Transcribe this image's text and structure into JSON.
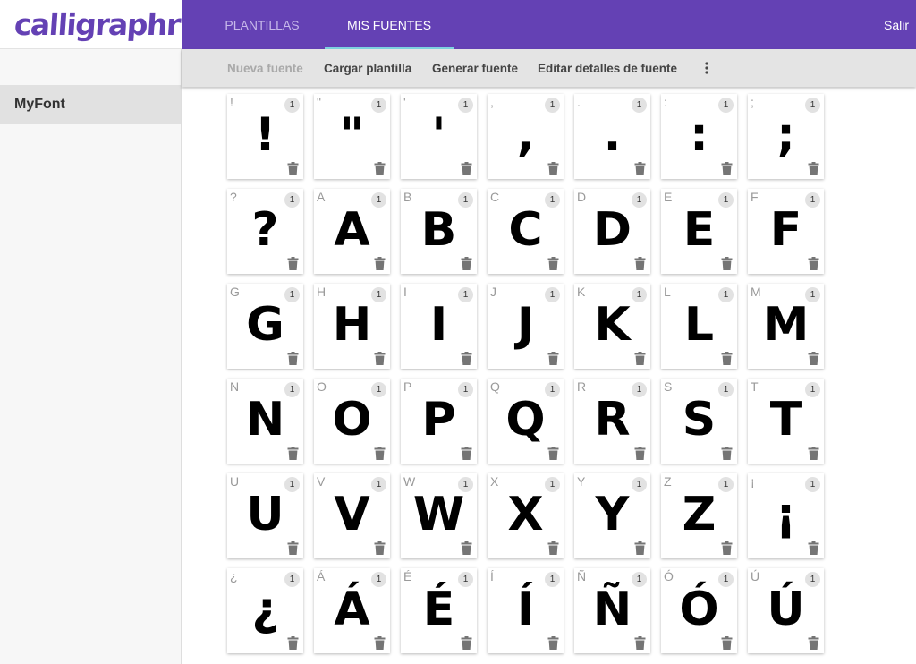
{
  "brand": {
    "logo_text": "calligraphr"
  },
  "nav": {
    "tabs": [
      {
        "label": "PLANTILLAS",
        "active": false
      },
      {
        "label": "MIS FUENTES",
        "active": true
      }
    ],
    "logout_label": "Salir"
  },
  "sidebar": {
    "fonts": [
      {
        "name": "MyFont",
        "selected": true
      }
    ]
  },
  "toolbar": {
    "new_font": "Nueva fuente",
    "load_template": "Cargar plantilla",
    "generate_font": "Generar fuente",
    "edit_details": "Editar detalles de fuente",
    "more_icon": "more-vert-icon"
  },
  "colors": {
    "header": "#6441b4",
    "active_tab_underline": "#7ed3e0",
    "toolbar_bg": "#e4e4e4",
    "sidebar_selected": "#e1e1e1"
  },
  "glyphs": [
    {
      "char": "!",
      "count": "1"
    },
    {
      "char": "\"",
      "count": "1"
    },
    {
      "char": "'",
      "count": "1"
    },
    {
      "char": ",",
      "count": "1"
    },
    {
      "char": ".",
      "count": "1"
    },
    {
      "char": ":",
      "count": "1"
    },
    {
      "char": ";",
      "count": "1"
    },
    {
      "char": "?",
      "count": "1"
    },
    {
      "char": "A",
      "count": "1"
    },
    {
      "char": "B",
      "count": "1"
    },
    {
      "char": "C",
      "count": "1"
    },
    {
      "char": "D",
      "count": "1"
    },
    {
      "char": "E",
      "count": "1"
    },
    {
      "char": "F",
      "count": "1"
    },
    {
      "char": "G",
      "count": "1"
    },
    {
      "char": "H",
      "count": "1"
    },
    {
      "char": "I",
      "count": "1"
    },
    {
      "char": "J",
      "count": "1"
    },
    {
      "char": "K",
      "count": "1"
    },
    {
      "char": "L",
      "count": "1"
    },
    {
      "char": "M",
      "count": "1"
    },
    {
      "char": "N",
      "count": "1"
    },
    {
      "char": "O",
      "count": "1"
    },
    {
      "char": "P",
      "count": "1"
    },
    {
      "char": "Q",
      "count": "1"
    },
    {
      "char": "R",
      "count": "1"
    },
    {
      "char": "S",
      "count": "1"
    },
    {
      "char": "T",
      "count": "1"
    },
    {
      "char": "U",
      "count": "1"
    },
    {
      "char": "V",
      "count": "1"
    },
    {
      "char": "W",
      "count": "1"
    },
    {
      "char": "X",
      "count": "1"
    },
    {
      "char": "Y",
      "count": "1"
    },
    {
      "char": "Z",
      "count": "1"
    },
    {
      "char": "¡",
      "count": "1"
    },
    {
      "char": "¿",
      "count": "1"
    },
    {
      "char": "Á",
      "count": "1"
    },
    {
      "char": "É",
      "count": "1"
    },
    {
      "char": "Í",
      "count": "1"
    },
    {
      "char": "Ñ",
      "count": "1"
    },
    {
      "char": "Ó",
      "count": "1"
    },
    {
      "char": "Ú",
      "count": "1"
    }
  ]
}
